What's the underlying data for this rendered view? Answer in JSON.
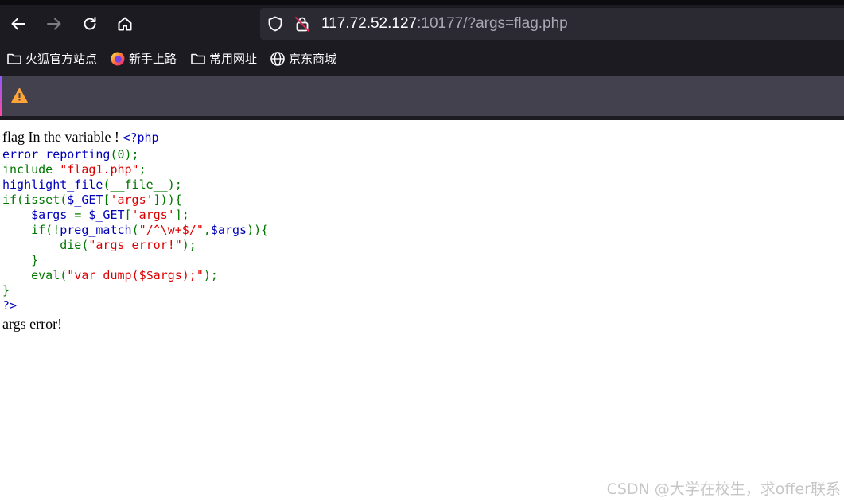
{
  "browser": {
    "url_host": "117.72.52.127",
    "url_rest": ":10177/?args=flag.php",
    "icons": {
      "back": "arrow-left-icon",
      "forward": "arrow-right-icon",
      "reload": "reload-icon",
      "home": "home-icon",
      "tracking": "shield-icon",
      "insecure": "insecure-lock-icon",
      "warning": "warning-triangle-icon"
    },
    "colors": {
      "toolbar_bg": "#1c1b22",
      "urlbar_bg": "#2b2a33",
      "notice_bg": "#42414d",
      "warning": "#ffa436"
    }
  },
  "bookmarks": [
    {
      "label": "火狐官方站点",
      "icon": "folder-icon"
    },
    {
      "label": "新手上路",
      "icon": "firefox-icon"
    },
    {
      "label": "常用网址",
      "icon": "folder-icon"
    },
    {
      "label": "京东商城",
      "icon": "globe-icon"
    }
  ],
  "page": {
    "intro": "flag In the variable ! ",
    "php_open": "<?php",
    "code": {
      "l1_fn": "error_reporting",
      "l1_rest": "(0);",
      "l2_kw": "include ",
      "l2_str": "\"flag1.php\"",
      "l2_end": ";",
      "l3_fn": "highlight_file",
      "l3_rest": "(__file__);",
      "l4_a": "if(isset(",
      "l4_var": "$_GET",
      "l4_b": "[",
      "l4_str": "'args'",
      "l4_c": "])){",
      "l5_indent": "    ",
      "l5_var": "$args ",
      "l5_eq": "= ",
      "l5_get": "$_GET",
      "l5_b": "[",
      "l5_str": "'args'",
      "l5_c": "];",
      "l6_indent": "    ",
      "l6_a": "if(!",
      "l6_fn": "preg_match",
      "l6_b": "(",
      "l6_str": "\"/^\\w+$/\"",
      "l6_c": ",",
      "l6_var": "$args",
      "l6_d": ")){",
      "l7_indent": "        ",
      "l7_a": "die(",
      "l7_str": "\"args error!\"",
      "l7_b": ");",
      "l8": "    }",
      "l9_indent": "    ",
      "l9_a": "eval(",
      "l9_str": "\"var_dump($$args);\"",
      "l9_b": ");",
      "l10": "}",
      "l11": "?>"
    },
    "result": "args error!"
  },
  "watermark": "CSDN @大学在校生，求offer联系"
}
